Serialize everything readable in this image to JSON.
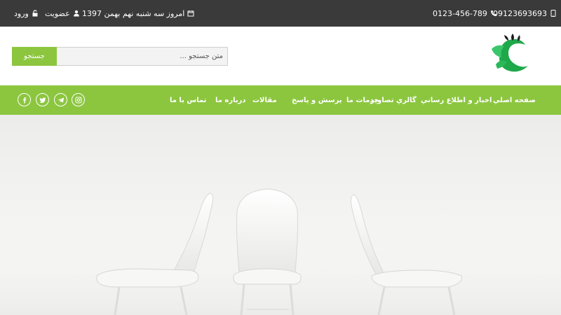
{
  "topbar": {
    "mobile": "09123693693",
    "phone": "0123-456-789",
    "date": "امروز سه شنبه نهم بهمن 1397",
    "signup": "عضویت",
    "login": "ورود"
  },
  "header": {
    "search_placeholder": "متن جستجو ...",
    "search_button": "جستجو"
  },
  "nav": {
    "items": [
      "صفحه اصلي",
      "اخبار و اطلاع رساني",
      "گالري تصاوير",
      "خدمات ما",
      "پرسش و پاسخ",
      "مقالات",
      "درباره ما",
      "تماس با ما"
    ]
  },
  "social": [
    "instagram-icon",
    "telegram-icon",
    "twitter-icon",
    "facebook-icon"
  ],
  "colors": {
    "topbar": "#3a3a3a",
    "accent": "#8cc63f"
  }
}
